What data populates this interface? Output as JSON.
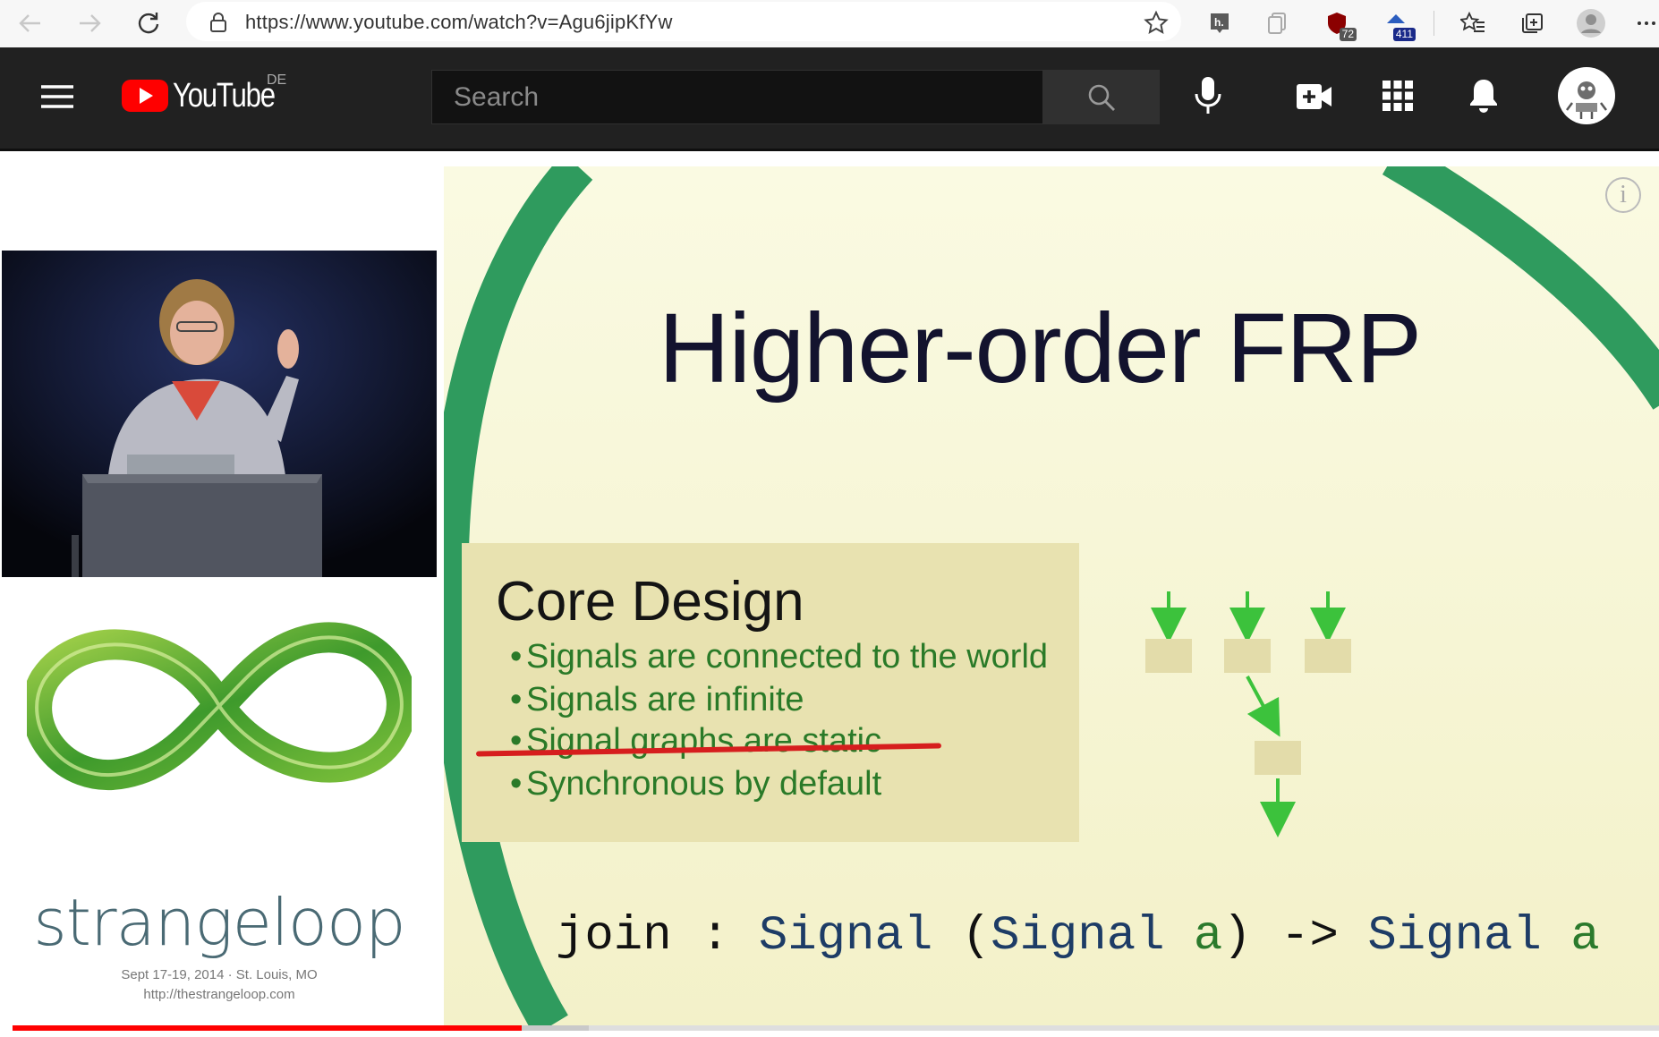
{
  "browser": {
    "url": "https://www.youtube.com/watch?v=Agu6jipKfYw",
    "extensions": [
      {
        "name": "hypothesis",
        "badge": ""
      },
      {
        "name": "collections",
        "badge": ""
      },
      {
        "name": "ublock",
        "badge": "72"
      },
      {
        "name": "extension-411",
        "badge": "411"
      }
    ]
  },
  "youtube": {
    "logo_text": "YouTube",
    "region": "DE",
    "search_placeholder": "Search"
  },
  "slide": {
    "title": "Higher-order FRP",
    "core_title": "Core Design",
    "bullets": [
      {
        "text": "Signals are connected to the world",
        "struck": false
      },
      {
        "text": "Signals are infinite",
        "struck": false
      },
      {
        "text": "Signal graphs are static",
        "struck": true
      },
      {
        "text": "Synchronous by default",
        "struck": false
      }
    ],
    "join": {
      "fn": "join",
      "colon": " : ",
      "t1": "Signal",
      "open": " (",
      "t2": "Signal",
      "a1": " a",
      "arrow": ") -> ",
      "t3": "Signal",
      "a2": " a"
    },
    "info": "i"
  },
  "branding": {
    "name": "strangeloop",
    "date_line": "Sept 17-19, 2014  ·  St. Louis, MO",
    "url_line": "http://thestrangeloop.com"
  },
  "player": {
    "played_fraction": 0.309,
    "buffered_fraction": 0.35
  },
  "colors": {
    "yt_red": "#ff0000",
    "header_bg": "#212121",
    "slide_green": "#2f9b5e",
    "diagram_green": "#3cc23c"
  }
}
